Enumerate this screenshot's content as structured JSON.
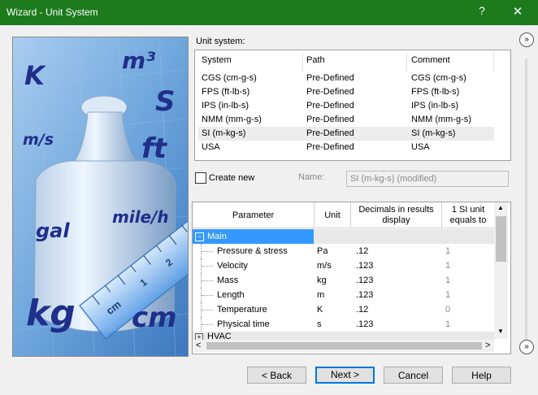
{
  "window": {
    "title": "Wizard - Unit System",
    "help_glyph": "?",
    "close_glyph": "✕"
  },
  "image_words": [
    "K",
    "m³",
    "S",
    "m/s",
    "ft",
    "gal",
    "mile/h",
    "kg",
    "cm",
    "cm",
    "1",
    "2",
    "3"
  ],
  "unit_system": {
    "label": "Unit system:",
    "columns": [
      "System",
      "Path",
      "Comment"
    ],
    "rows": [
      {
        "system": "CGS (cm-g-s)",
        "path": "Pre-Defined",
        "comment": "CGS (cm-g-s)"
      },
      {
        "system": "FPS (ft-lb-s)",
        "path": "Pre-Defined",
        "comment": "FPS (ft-lb-s)"
      },
      {
        "system": "IPS (in-lb-s)",
        "path": "Pre-Defined",
        "comment": "IPS (in-lb-s)"
      },
      {
        "system": "NMM (mm-g-s)",
        "path": "Pre-Defined",
        "comment": "NMM (mm-g-s)"
      },
      {
        "system": "SI (m-kg-s)",
        "path": "Pre-Defined",
        "comment": "SI (m-kg-s)"
      },
      {
        "system": "USA",
        "path": "Pre-Defined",
        "comment": "USA"
      }
    ],
    "selected_index": 4
  },
  "create_new": {
    "label": "Create new",
    "checked": false
  },
  "name_field": {
    "label": "Name:",
    "value": "SI (m-kg-s) (modified)"
  },
  "params": {
    "columns": [
      "Parameter",
      "Unit",
      "Decimals in results display",
      "1 SI unit equals to"
    ],
    "group_main": {
      "toggle": "−",
      "label": "Main"
    },
    "rows": [
      {
        "name": "Pressure & stress",
        "unit": "Pa",
        "decimals": ".12",
        "si": "1"
      },
      {
        "name": "Velocity",
        "unit": "m/s",
        "decimals": ".123",
        "si": "1"
      },
      {
        "name": "Mass",
        "unit": "kg",
        "decimals": ".123",
        "si": "1"
      },
      {
        "name": "Length",
        "unit": "m",
        "decimals": ".123",
        "si": "1"
      },
      {
        "name": "Temperature",
        "unit": "K",
        "decimals": ".12",
        "si": "0"
      },
      {
        "name": "Physical time",
        "unit": "s",
        "decimals": ".123",
        "si": "1"
      }
    ],
    "group_hvac": {
      "toggle": "+",
      "label": "HVAC"
    }
  },
  "side": {
    "top_glyph": "»",
    "bottom_glyph": "»"
  },
  "scroll": {
    "up": "▲",
    "down": "▼",
    "left": "<",
    "right": ">"
  },
  "buttons": {
    "back": "< Back",
    "next": "Next >",
    "cancel": "Cancel",
    "help": "Help"
  },
  "colors": {
    "title_bar": "#1d7a1d",
    "selected_group": "#3399ff",
    "image_bg": "#7db0e0"
  }
}
